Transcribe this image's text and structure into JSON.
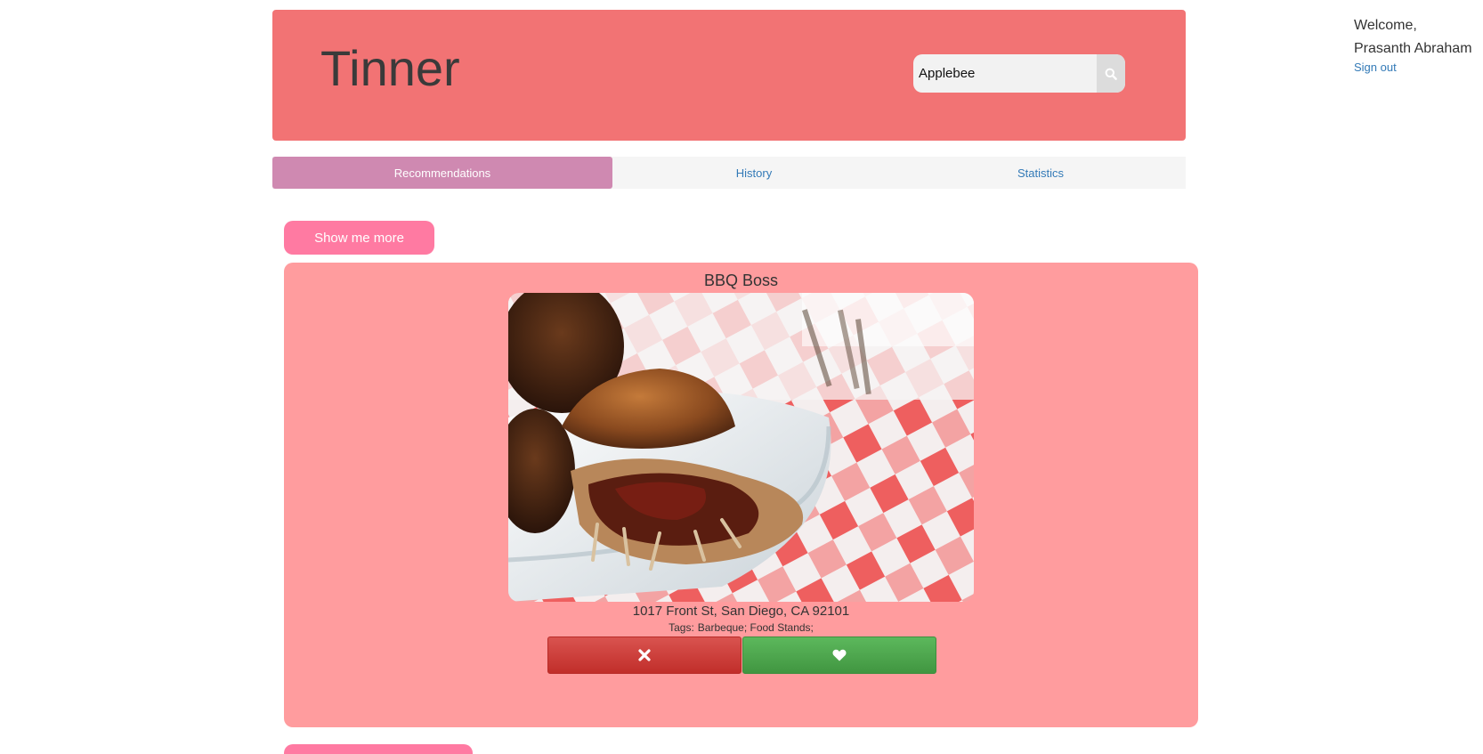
{
  "header": {
    "brand": "Tinner",
    "search": {
      "value": "Applebee",
      "icon": "search-icon"
    }
  },
  "user": {
    "welcome": "Welcome,",
    "name": "Prasanth Abraham",
    "signout_label": "Sign out"
  },
  "tabs": [
    {
      "label": "Recommendations",
      "active": true
    },
    {
      "label": "History",
      "active": false
    },
    {
      "label": "Statistics",
      "active": false
    }
  ],
  "show_more_label": "Show me more",
  "card": {
    "title": "BBQ Boss",
    "address": "1017 Front St, San Diego, CA 92101",
    "tags_prefix": "Tags:",
    "tags": "Barbeque; Food Stands;",
    "dislike_icon": "close-icon",
    "like_icon": "heart-icon"
  },
  "colors": {
    "header_bg": "#f27374",
    "tab_active": "#cf89b1",
    "button_pink": "#ff7aa2",
    "card_bg": "#ff9c9e",
    "dislike": "#d9534f",
    "like": "#5cb85c",
    "link": "#337ab7"
  }
}
